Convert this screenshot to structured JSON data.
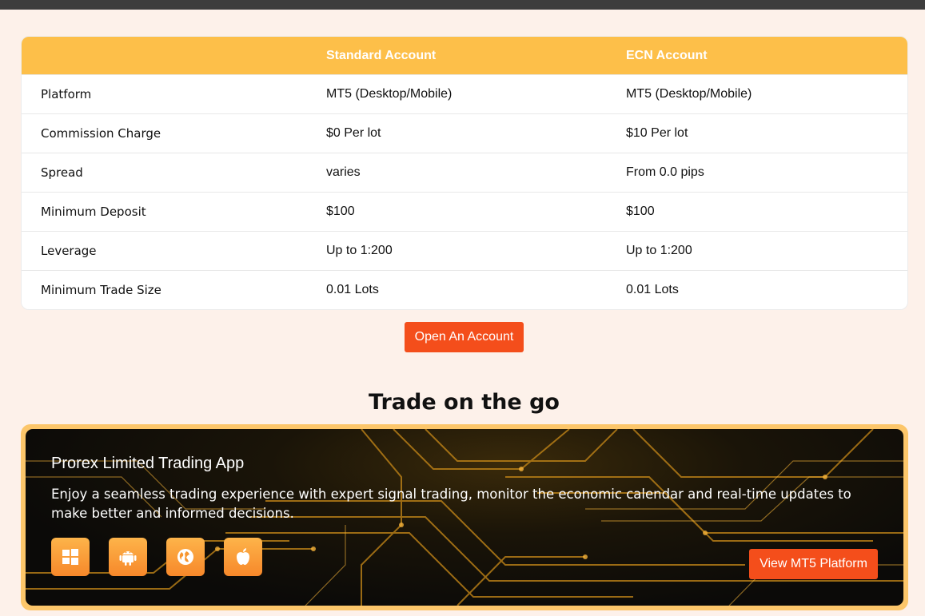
{
  "table": {
    "headers": [
      "",
      "Standard Account",
      "ECN Account"
    ],
    "rows": [
      [
        "Platform",
        "MT5 (Desktop/Mobile)",
        "MT5 (Desktop/Mobile)"
      ],
      [
        "Commission Charge",
        "$0 Per lot",
        "$10 Per lot"
      ],
      [
        "Spread",
        "varies",
        "From 0.0 pips"
      ],
      [
        "Minimum Deposit",
        "$100",
        "$100"
      ],
      [
        "Leverage",
        "Up to 1:200",
        "Up to 1:200"
      ],
      [
        "Minimum Trade Size",
        "0.01 Lots",
        "0.01 Lots"
      ]
    ]
  },
  "open_account_label": "Open An Account",
  "section_title": "Trade on the go",
  "banner": {
    "title": "Prorex Limited Trading App",
    "description": "Enjoy a seamless trading experience with expert signal trading, monitor the economic calendar and real-time updates to make better and informed decisions.",
    "platform_icons": [
      "windows-icon",
      "android-icon",
      "web-globe-icon",
      "apple-icon"
    ],
    "button_label": "View MT5 Platform"
  },
  "colors": {
    "header_yellow": "#fdbf49",
    "button_orange": "#f44e1b",
    "page_background": "#fdf1ea",
    "banner_border": "#fcc66a"
  }
}
